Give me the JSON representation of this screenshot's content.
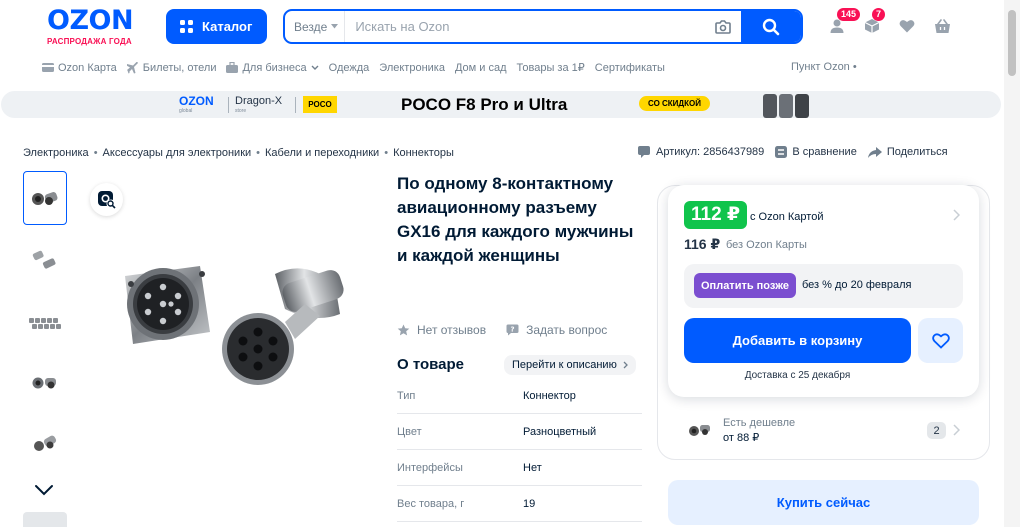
{
  "header": {
    "logo_text": "OZON",
    "logo_sub": "РАСПРОДАЖА ГОДА",
    "catalog_label": "Каталог",
    "search_scope": "Везде",
    "search_placeholder": "Искать на Ozon",
    "orders_badge": "145",
    "cart_badge": "7"
  },
  "subnav": {
    "items": [
      "Ozon Карта",
      "Билеты, отели",
      "Для бизнеса",
      "Одежда",
      "Электроника",
      "Дом и сад",
      "Товары за 1₽",
      "Сертификаты"
    ],
    "pickup": "Пункт Ozon"
  },
  "banner": {
    "brand1": "OZON",
    "brand1_sub": "global",
    "brand2": "Dragon-X",
    "brand2_sub": "store",
    "brand3": "POCO",
    "title": "POCO F8 Pro и Ultra",
    "pill": "СО СКИДКОЙ"
  },
  "breadcrumbs": [
    "Электроника",
    "Аксессуары для электроники",
    "Кабели и переходники",
    "Коннекторы"
  ],
  "meta": {
    "article": "Артикул: 2856437989",
    "compare": "В сравнение",
    "share": "Поделиться"
  },
  "product": {
    "title": "По одному 8-контактному авиационному разъему GX16 для каждого мужчины и каждой женщины",
    "reviews": "Нет отзывов",
    "ask": "Задать вопрос",
    "about_heading": "О товаре",
    "about_link": "Перейти к описанию",
    "specs": [
      {
        "key": "Тип",
        "value": "Коннектор"
      },
      {
        "key": "Цвет",
        "value": "Разноцветный"
      },
      {
        "key": "Интерфейсы",
        "value": "Нет"
      },
      {
        "key": "Вес товара, г",
        "value": "19"
      }
    ]
  },
  "price": {
    "card_price": "112 ₽",
    "card_label": "с Ozon Картой",
    "regular_price": "116 ₽",
    "regular_label": "без Ozon Карты",
    "pay_later_btn": "Оплатить позже",
    "pay_later_text": "без % до 20 февраля",
    "add_to_cart": "Добавить в корзину",
    "delivery": "Доставка с 25 декабря"
  },
  "cheaper": {
    "label": "Есть дешевле",
    "price": "от 88 ₽",
    "count": "2"
  },
  "buy_now": "Купить сейчас",
  "colors": {
    "brand_blue": "#005bff",
    "green_price": "#10c44c",
    "pay_later": "#7b4ed0",
    "badge_pink": "#f91155"
  }
}
